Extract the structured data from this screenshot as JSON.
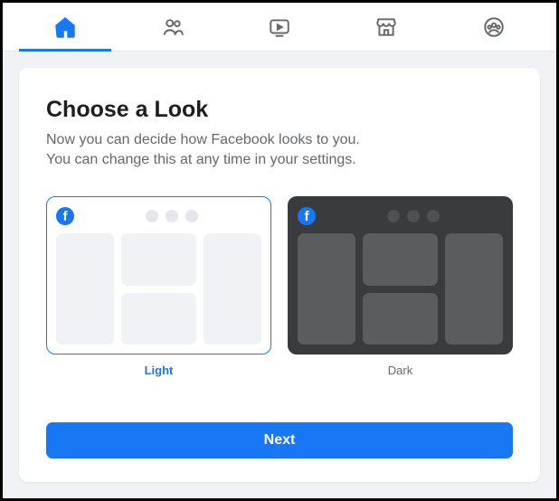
{
  "nav": {
    "items": [
      {
        "name": "home",
        "active": true
      },
      {
        "name": "friends",
        "active": false
      },
      {
        "name": "watch",
        "active": false
      },
      {
        "name": "marketplace",
        "active": false
      },
      {
        "name": "groups",
        "active": false
      }
    ]
  },
  "dialog": {
    "title": "Choose a Look",
    "description_line1": "Now you can decide how Facebook looks to you.",
    "description_line2": "You can change this at any time in your settings.",
    "options": [
      {
        "key": "light",
        "label": "Light",
        "selected": true
      },
      {
        "key": "dark",
        "label": "Dark",
        "selected": false
      }
    ],
    "next_label": "Next"
  },
  "colors": {
    "accent": "#1877f2",
    "surface": "#ffffff",
    "muted_bg": "#f0f2f5",
    "text_primary": "#1c1e21",
    "text_secondary": "#65676b",
    "dark_surface": "#3a3b3c"
  }
}
